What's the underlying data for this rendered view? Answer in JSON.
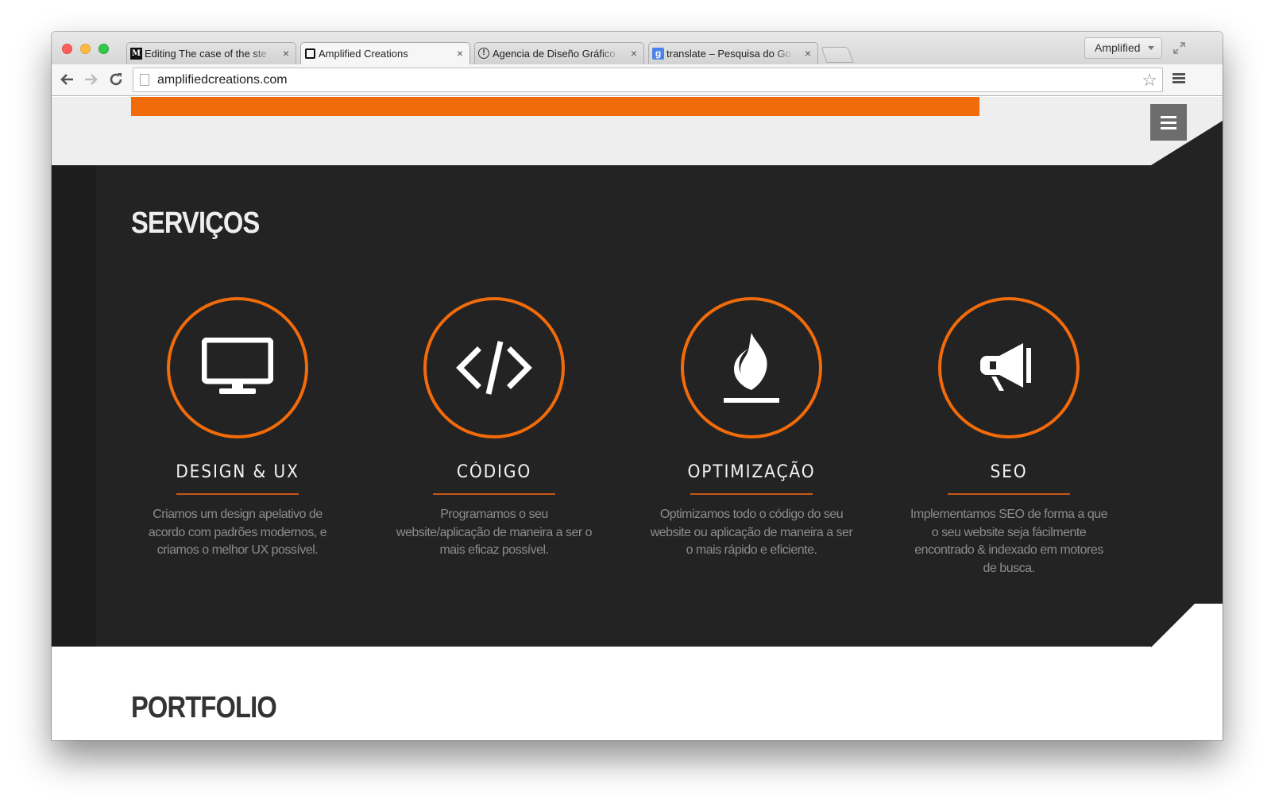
{
  "browser": {
    "tabs": [
      {
        "favicon": "M",
        "title": "Editing The case of the ste",
        "close": "×",
        "active": false
      },
      {
        "favicon": "",
        "title": "Amplified Creations",
        "close": "×",
        "active": true
      },
      {
        "favicon": "!",
        "title": "Agencia de Diseño Gráfico",
        "close": "×",
        "active": false
      },
      {
        "favicon": "g",
        "title": "translate – Pesquisa do Go",
        "close": "×",
        "active": false
      }
    ],
    "profile_label": "Amplified",
    "url": "amplifiedcreations.com",
    "icons": [
      "back-arrow-icon",
      "forward-arrow-icon",
      "reload-icon",
      "bookmark-star-icon",
      "chrome-menu-icon",
      "fullscreen-icon"
    ]
  },
  "page": {
    "colors": {
      "accent": "#f26b0a",
      "dark": "#232323",
      "light": "#eeeeee"
    },
    "services": {
      "title": "SERVIÇOS",
      "items": [
        {
          "icon": "monitor-icon",
          "title": "DESIGN & UX",
          "description": "Criamos um design apelativo de acordo com padrões modernos, e criamos o melhor UX possível."
        },
        {
          "icon": "code-icon",
          "title": "CÓDIGO",
          "description": "Programamos o seu website/aplicação de maneira a ser o mais eficaz possível."
        },
        {
          "icon": "flame-icon",
          "title": "OPTIMIZAÇÃO",
          "description": "Optimizamos todo o código do seu website ou aplicação de maneira a ser o mais rápido e eficiente."
        },
        {
          "icon": "megaphone-icon",
          "title": "SEO",
          "description": "Implementamos SEO de forma a que o seu website seja fácilmente encontrado & indexado em motores de busca."
        }
      ]
    },
    "portfolio": {
      "title": "PORTFOLIO"
    }
  }
}
